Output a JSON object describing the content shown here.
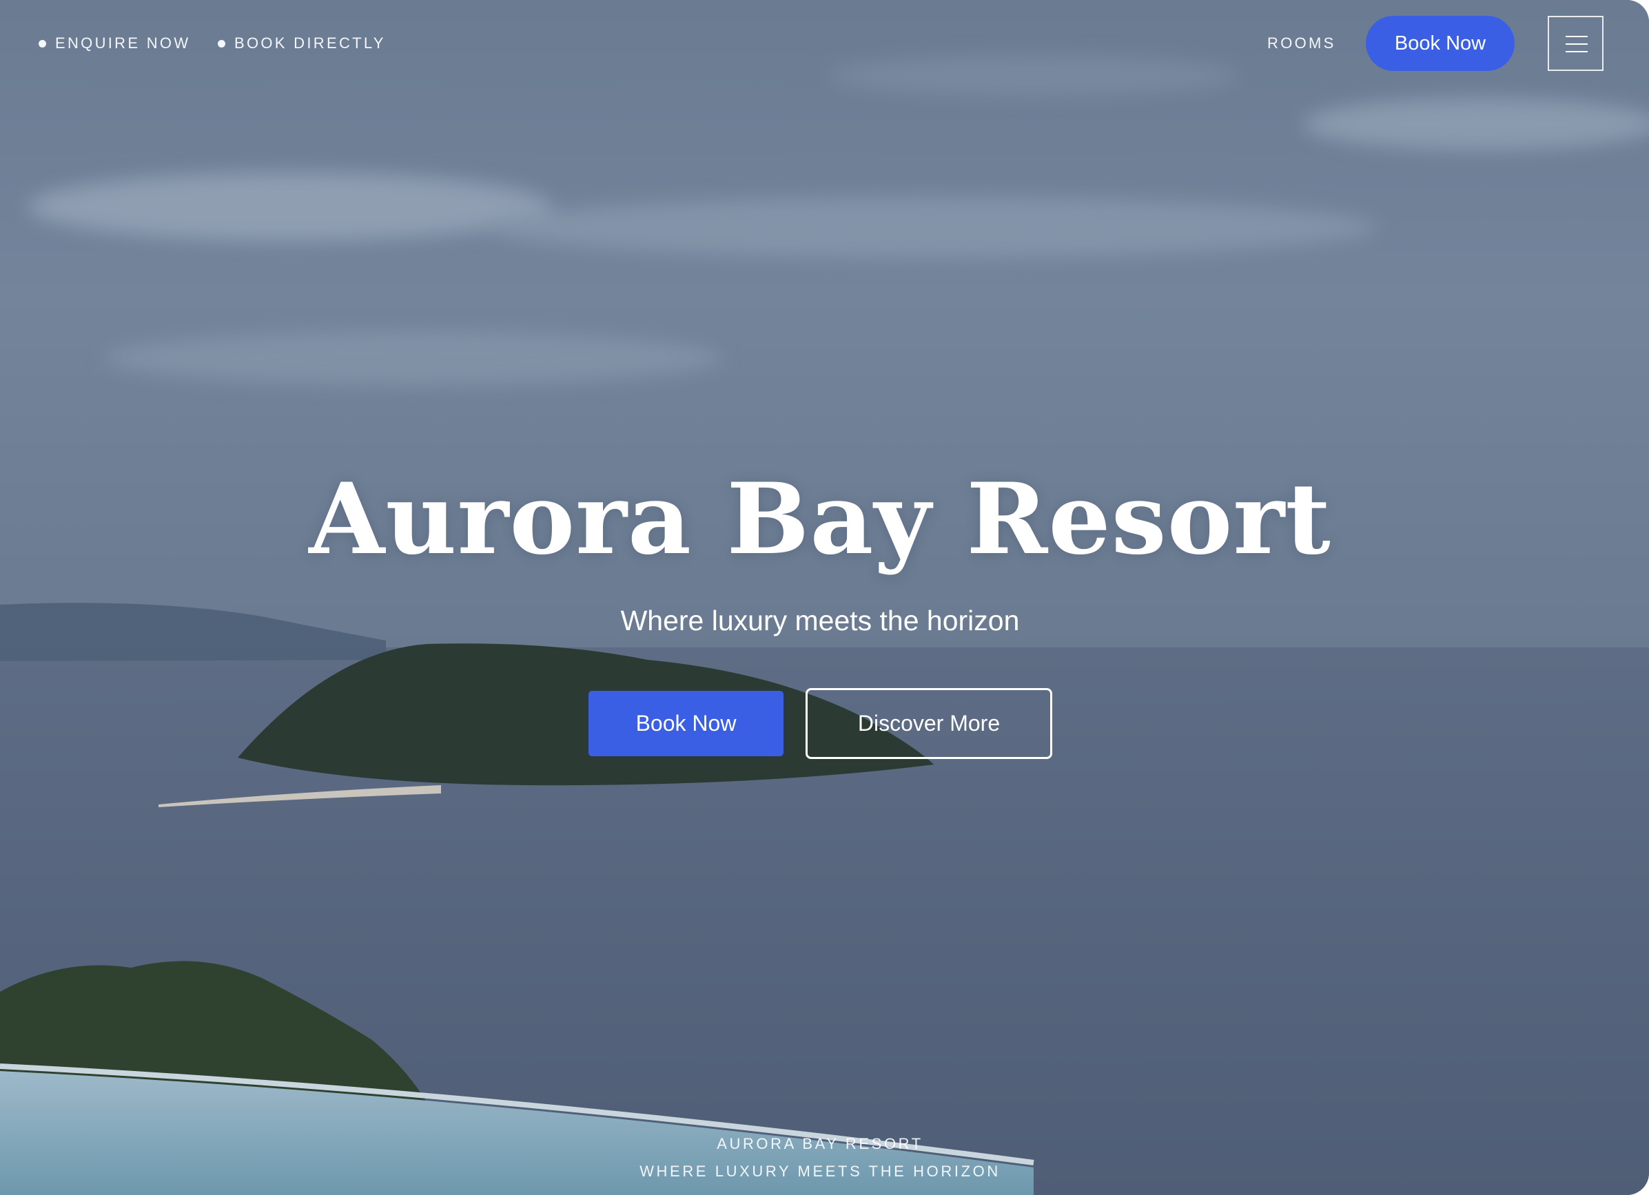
{
  "header": {
    "enquire_label": "ENQUIRE NOW",
    "book_directly_label": "BOOK DIRECTLY",
    "rooms_label": "ROOMS",
    "book_now_label": "Book Now",
    "menu_icon": "hamburger-menu-icon"
  },
  "hero": {
    "title": "Aurora Bay Resort",
    "subtitle": "Where luxury meets the horizon",
    "primary_cta": "Book Now",
    "secondary_cta": "Discover More"
  },
  "footer_caption": {
    "name": "AURORA BAY RESORT",
    "tagline": "WHERE LUXURY MEETS THE HORIZON"
  },
  "colors": {
    "accent": "#3a5fe5",
    "text": "#ffffff",
    "sky": "#6d7e94",
    "sea": "#56657d"
  }
}
